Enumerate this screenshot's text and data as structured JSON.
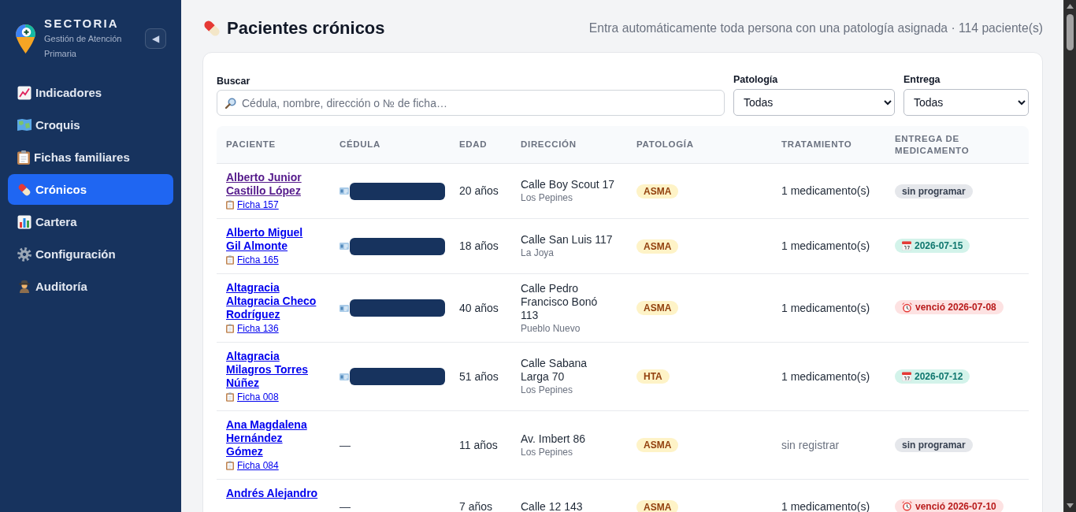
{
  "sidebar": {
    "brand": {
      "name": "SECTORIA",
      "subtitle": "Gestión de Atención Primaria"
    },
    "collapse_button": {
      "label": "◀"
    },
    "items": [
      {
        "label": "Indicadores",
        "selected": false
      },
      {
        "label": "Croquis",
        "selected": false
      },
      {
        "label": "Fichas familiares",
        "selected": false
      },
      {
        "label": "Crónicos",
        "selected": true
      },
      {
        "label": "Cartera",
        "selected": false
      },
      {
        "label": "Configuración",
        "selected": false
      },
      {
        "label": "Auditoría",
        "selected": false
      }
    ]
  },
  "header": {
    "title": "Pacientes crónicos",
    "summary": "Entra automáticamente toda persona con una patología asignada · 114 paciente(s)"
  },
  "filters": {
    "search": {
      "label": "Buscar",
      "placeholder": "Cédula, nombre, dirección o № de ficha…"
    },
    "pathology": {
      "label": "Patología",
      "value": "Todas"
    },
    "delivery": {
      "label": "Entrega",
      "value": "Todas"
    }
  },
  "table": {
    "columns": [
      "PACIENTE",
      "CÉDULA",
      "EDAD",
      "DIRECCIÓN",
      "PATOLOGÍA",
      "TRATAMIENTO",
      "ENTREGA DE MEDICAMENTO"
    ],
    "rows": [
      {
        "patient": {
          "name": "Alberto Junior Castillo López",
          "visited": true,
          "record": "Ficha 157"
        },
        "cedula": {
          "kind": "redacted"
        },
        "age": "20 años",
        "address": {
          "street": "Calle Boy Scout 17",
          "area": "Los Pepines"
        },
        "pathology": "ASMA",
        "treatment": {
          "kind": "count",
          "text": "1 medicamento(s)"
        },
        "delivery": {
          "kind": "unscheduled",
          "text": "sin programar"
        }
      },
      {
        "patient": {
          "name": "Alberto Miguel Gil Almonte",
          "visited": false,
          "record": "Ficha 165"
        },
        "cedula": {
          "kind": "redacted"
        },
        "age": "18 años",
        "address": {
          "street": "Calle San Luis 117",
          "area": "La Joya"
        },
        "pathology": "ASMA",
        "treatment": {
          "kind": "count",
          "text": "1 medicamento(s)"
        },
        "delivery": {
          "kind": "scheduled",
          "text": "2026-07-15"
        }
      },
      {
        "patient": {
          "name": "Altagracia Altagracia Checo Rodríguez",
          "visited": false,
          "record": "Ficha 136"
        },
        "cedula": {
          "kind": "redacted"
        },
        "age": "40 años",
        "address": {
          "street": "Calle Pedro Francisco Bonó 113",
          "area": "Pueblo Nuevo"
        },
        "pathology": "ASMA",
        "treatment": {
          "kind": "count",
          "text": "1 medicamento(s)"
        },
        "delivery": {
          "kind": "overdue",
          "text": "venció 2026-07-08"
        }
      },
      {
        "patient": {
          "name": "Altagracia Milagros Torres Núñez",
          "visited": false,
          "record": "Ficha 008"
        },
        "cedula": {
          "kind": "redacted"
        },
        "age": "51 años",
        "address": {
          "street": "Calle Sabana Larga 70",
          "area": "Los Pepines"
        },
        "pathology": "HTA",
        "treatment": {
          "kind": "count",
          "text": "1 medicamento(s)"
        },
        "delivery": {
          "kind": "scheduled",
          "text": "2026-07-12"
        }
      },
      {
        "patient": {
          "name": "Ana Magdalena Hernández Gómez",
          "visited": false,
          "record": "Ficha 084"
        },
        "cedula": {
          "kind": "text",
          "text": "—"
        },
        "age": "11 años",
        "address": {
          "street": "Av. Imbert 86",
          "area": "Los Pepines"
        },
        "pathology": "ASMA",
        "treatment": {
          "kind": "none",
          "text": "sin registrar"
        },
        "delivery": {
          "kind": "unscheduled",
          "text": "sin programar"
        }
      },
      {
        "patient": {
          "name": "Andrés Alejandro",
          "visited": false
        },
        "cedula": {
          "kind": "text",
          "text": "—"
        },
        "age": "7 años",
        "address": {
          "street": "Calle 12 143"
        },
        "pathology": "ASMA",
        "treatment": {
          "kind": "count",
          "text": "1 medicamento(s)"
        },
        "delivery": {
          "kind": "overdue",
          "text": "venció 2026-07-10"
        }
      }
    ]
  }
}
